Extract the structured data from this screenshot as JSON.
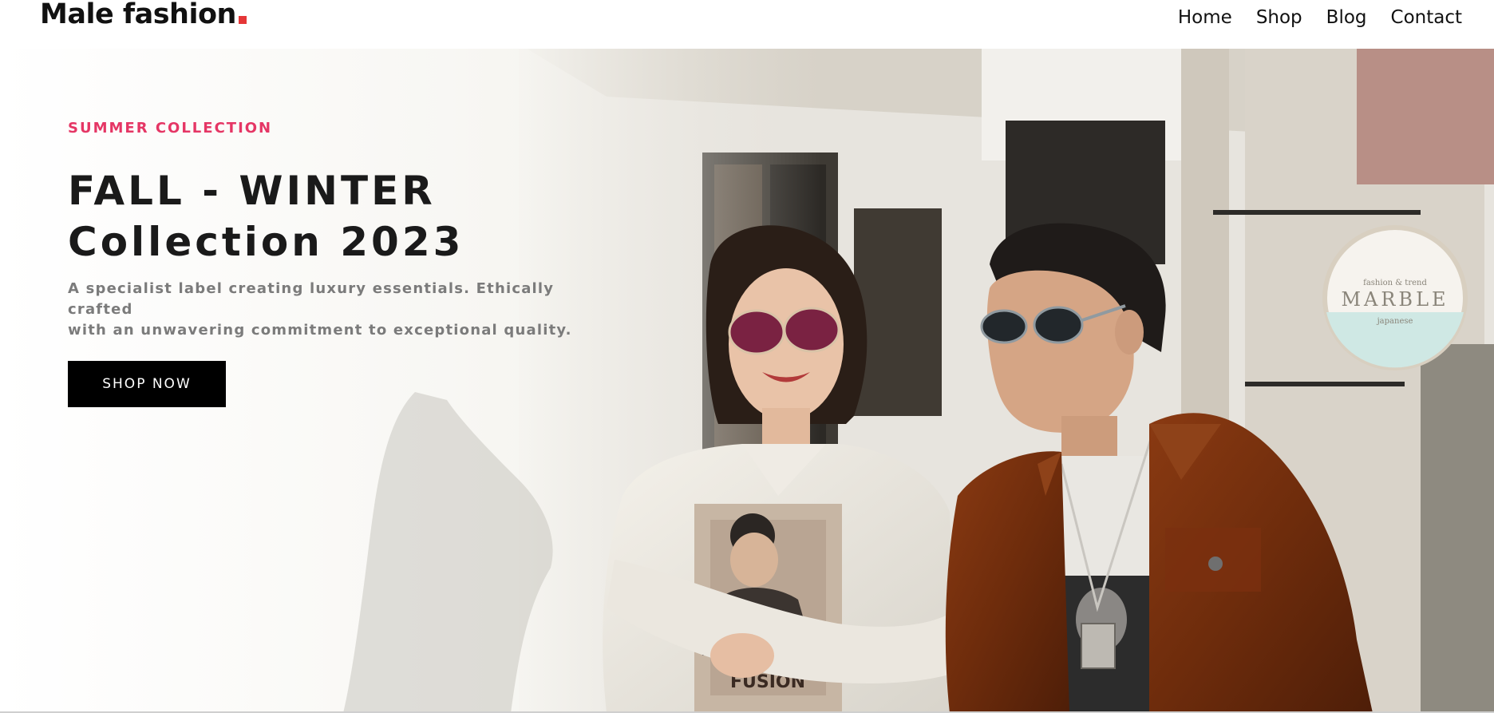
{
  "header": {
    "logo_text": "Male fashion",
    "nav": [
      {
        "label": "Home"
      },
      {
        "label": "Shop"
      },
      {
        "label": "Blog"
      },
      {
        "label": "Contact"
      }
    ]
  },
  "hero": {
    "eyebrow": "SUMMER COLLECTION",
    "headline_line1": "FALL - WINTER",
    "headline_line2": "Collection 2023",
    "description_line1": "A specialist label creating luxury essentials. Ethically crafted",
    "description_line2": "with an unwavering commitment to exceptional quality.",
    "cta_label": "SHOP NOW",
    "photo_sign_line1": "fashion & trend",
    "photo_sign_line2": "MARBLE",
    "photo_sign_line3": "japanese",
    "photo_magazine_text": "FUSION"
  },
  "colors": {
    "accent": "#e53637",
    "eyebrow": "#e53665",
    "headline": "#1a1a1a",
    "description": "#7b7b7b",
    "button_bg": "#000000",
    "button_text": "#ffffff"
  }
}
